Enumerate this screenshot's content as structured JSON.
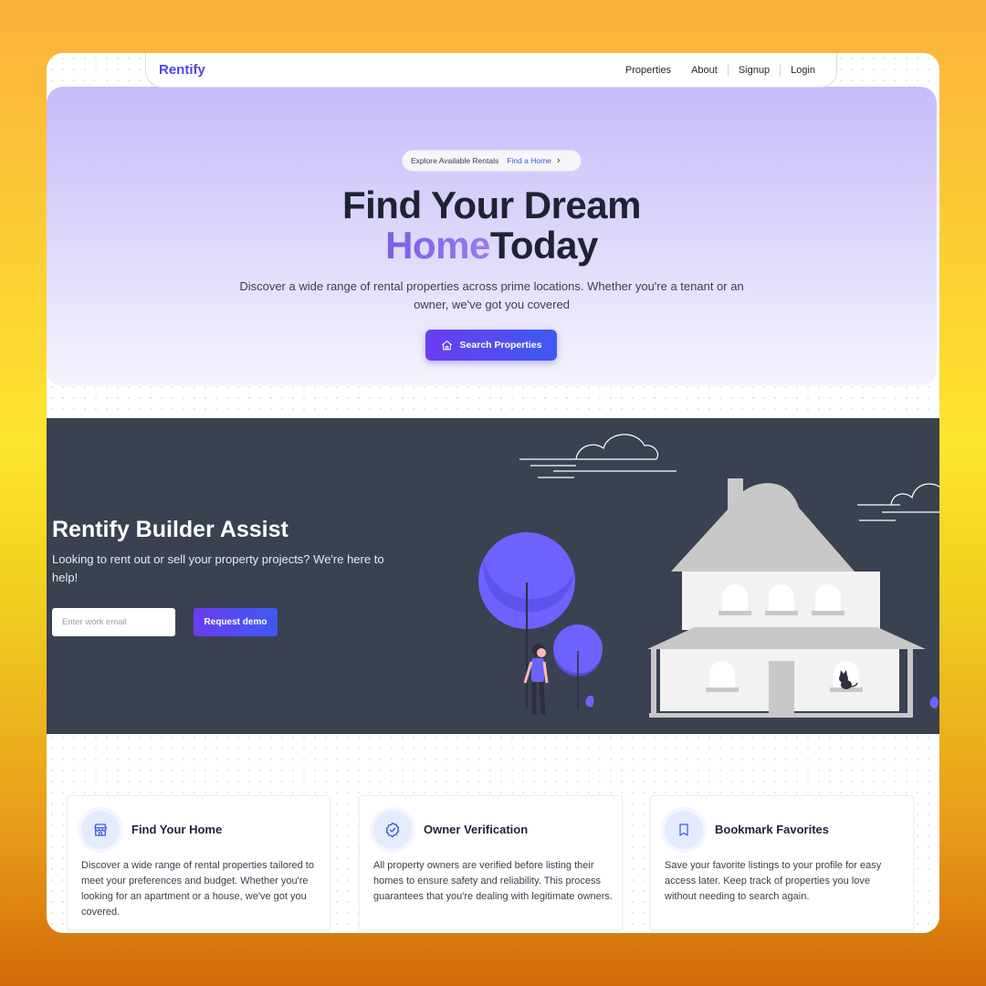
{
  "nav": {
    "brand": "Rentify",
    "links": [
      "Properties",
      "About",
      "Signup",
      "Login"
    ]
  },
  "hero": {
    "pill_text": "Explore Available Rentals",
    "pill_link": "Find a Home",
    "title_line1": "Find Your Dream",
    "title_accent": "Home",
    "title_rest": "Today",
    "subtitle": "Discover a wide range of rental properties across prime locations. Whether you're a tenant or an owner, we've got you covered",
    "button_label": "Search Properties"
  },
  "builder": {
    "title": "Rentify Builder Assist",
    "subtitle": "Looking to rent out or sell your property projects? We're here to help!",
    "email_placeholder": "Enter work email",
    "button_label": "Request demo"
  },
  "features": [
    {
      "icon": "storefront-icon",
      "title": "Find Your Home",
      "body": "Discover a wide range of rental properties tailored to meet your preferences and budget. Whether you're looking for an apartment or a house, we've got you covered."
    },
    {
      "icon": "verified-badge-icon",
      "title": "Owner Verification",
      "body": "All property owners are verified before listing their homes to ensure safety and reliability. This process guarantees that you're dealing with legitimate owners."
    },
    {
      "icon": "bookmark-icon",
      "title": "Bookmark Favorites",
      "body": "Save your favorite listings to your profile for easy access later. Keep track of properties you love without needing to search again."
    }
  ],
  "colors": {
    "brand": "#4f46e5",
    "accent_gradient_start": "#6a3df0",
    "accent_gradient_end": "#3e5af0",
    "dark_section": "#3a4150",
    "illustration_purple": "#6c63ff"
  }
}
